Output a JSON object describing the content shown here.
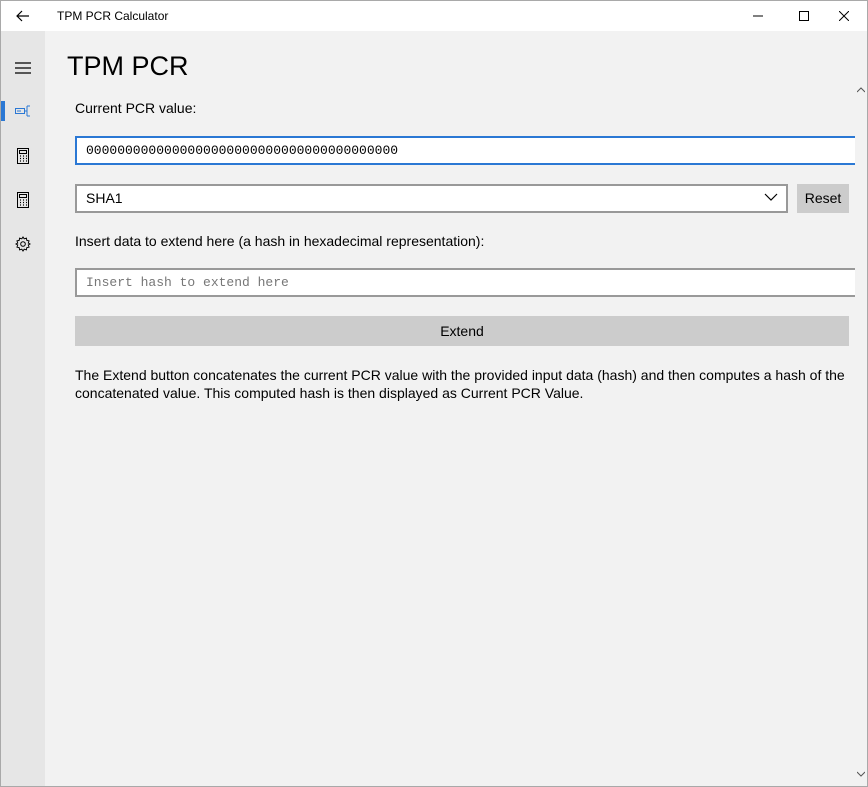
{
  "window": {
    "title": "TPM PCR Calculator"
  },
  "nav": {
    "items": [
      {
        "name": "hamburger-menu-icon"
      },
      {
        "name": "pcr-calculator-icon",
        "active": true
      },
      {
        "name": "calculator-icon"
      },
      {
        "name": "calculator-icon-2"
      },
      {
        "name": "settings-gear-icon"
      }
    ]
  },
  "page": {
    "title": "TPM PCR",
    "current_pcr_label": "Current PCR value:",
    "current_pcr_value": "0000000000000000000000000000000000000000",
    "hash_algorithm": "SHA1",
    "reset_label": "Reset",
    "insert_label": "Insert data to extend here (a hash in hexadecimal representation):",
    "insert_placeholder": "Insert hash to extend here",
    "insert_value": "",
    "extend_label": "Extend",
    "description": "The Extend button concatenates the current PCR value with the provided input data (hash) and then computes a hash of the concatenated value. This computed hash is then displayed as Current PCR Value."
  },
  "colors": {
    "accent": "#2b78d4",
    "nav_background": "#e6e6e6",
    "content_background": "#f2f2f2",
    "button_background": "#cccccc"
  }
}
